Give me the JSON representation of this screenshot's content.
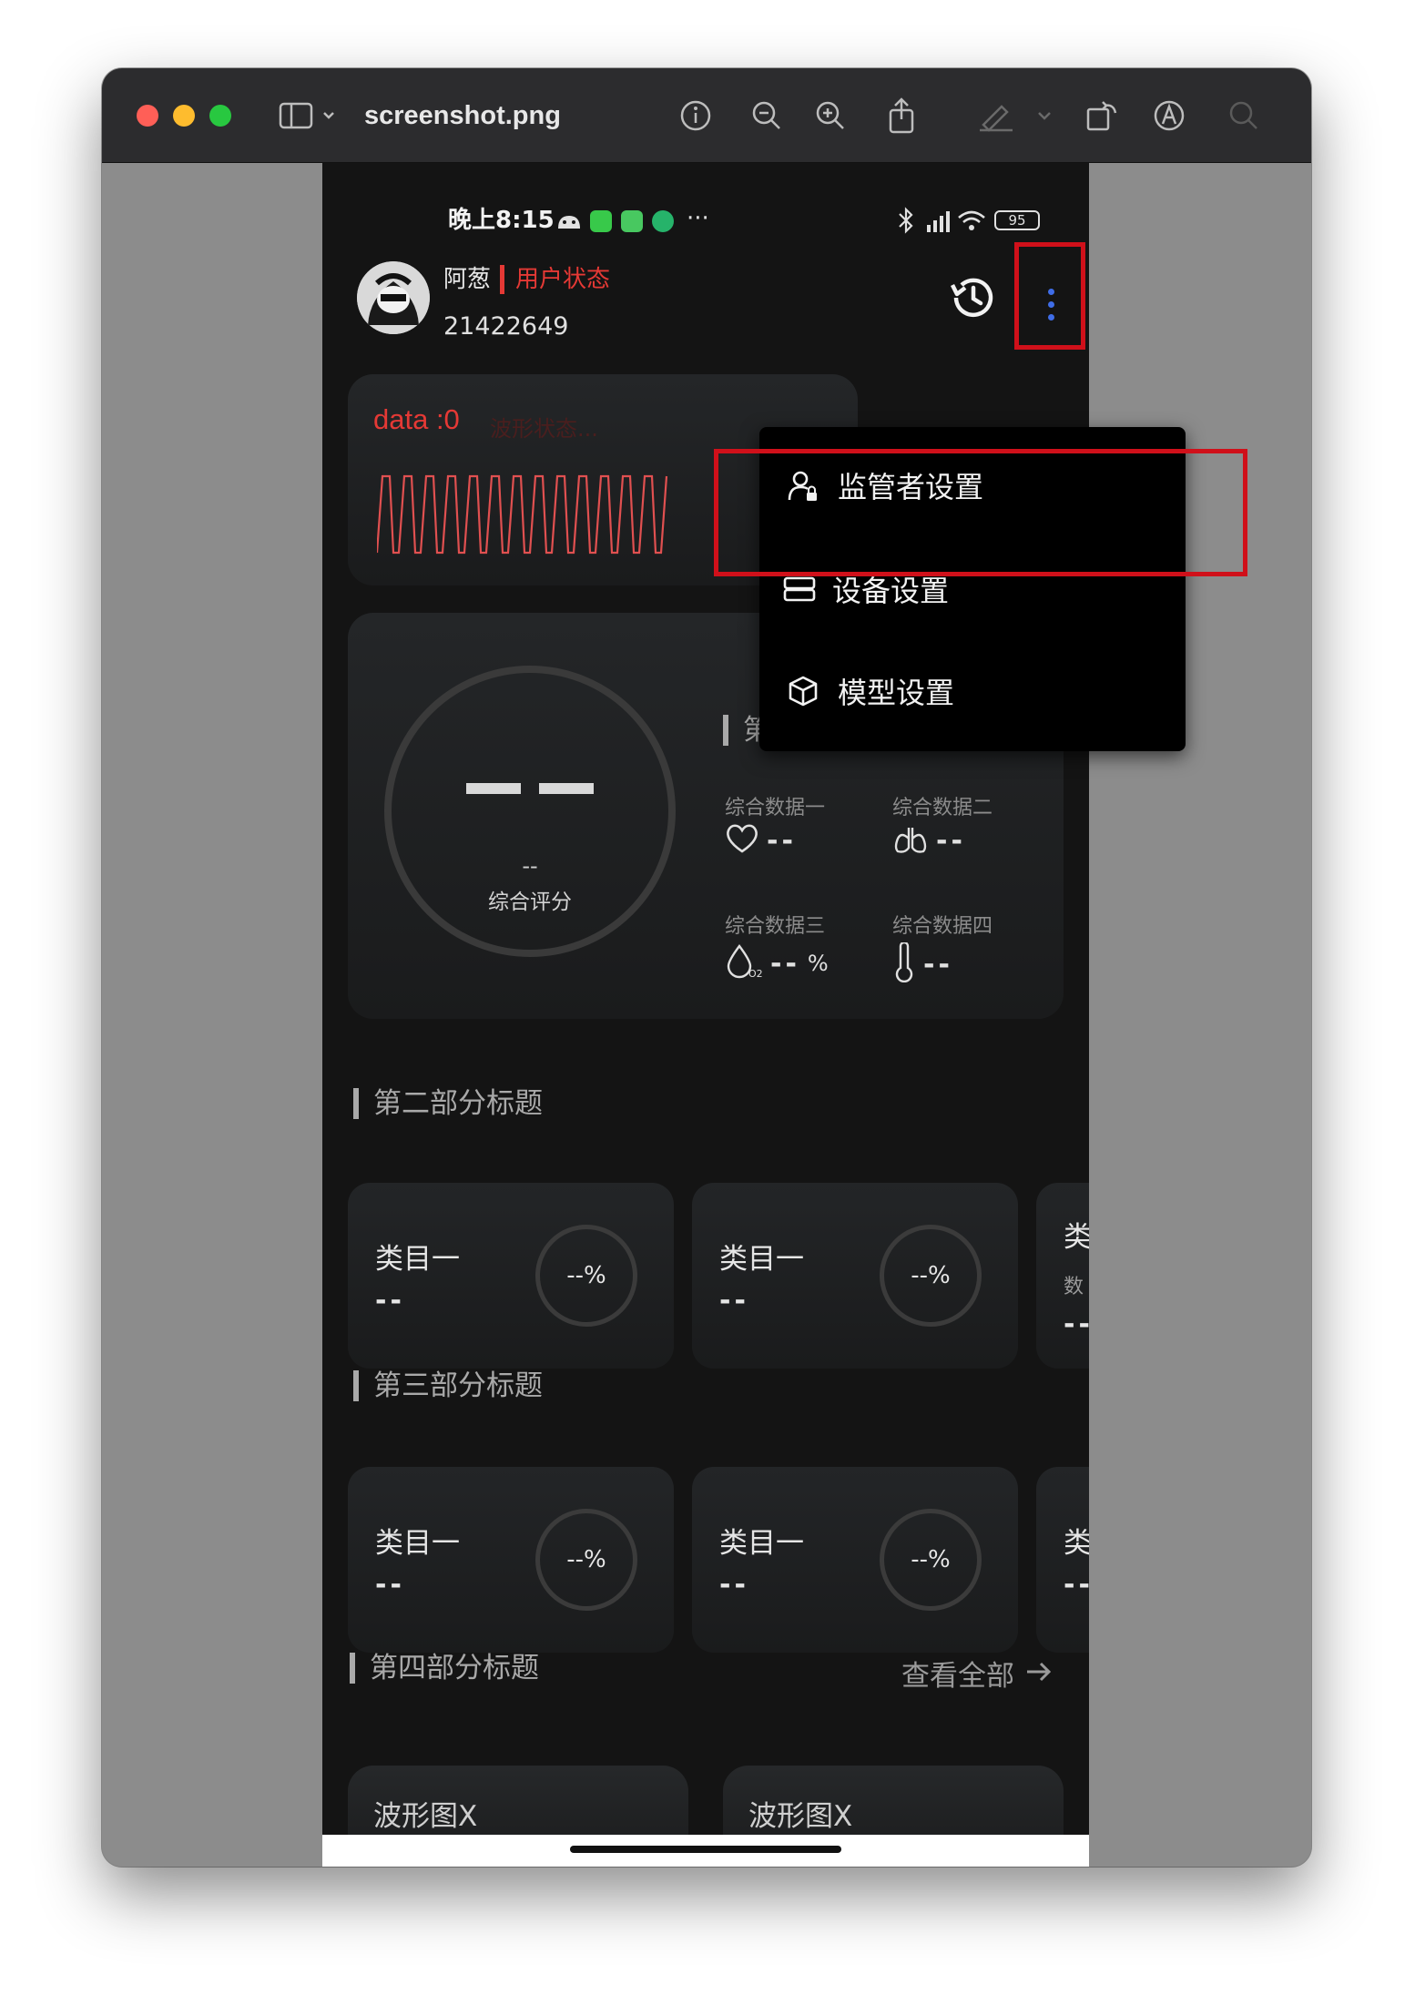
{
  "window": {
    "title": "screenshot.png"
  },
  "status_bar": {
    "time": "晚上8:15",
    "battery": "95"
  },
  "header": {
    "user_name": "阿葱",
    "user_status": "用户状态",
    "user_id": "21422649"
  },
  "wave_card": {
    "data_label": "data :0",
    "wave_status": "波形状态..."
  },
  "score": {
    "sub_value": "--",
    "label": "综合评分"
  },
  "section1": {
    "title": "第一部分标题",
    "metrics": [
      {
        "label": "综合数据一",
        "value": "--",
        "unit": "",
        "icon": "heart-icon"
      },
      {
        "label": "综合数据二",
        "value": "--",
        "unit": "",
        "icon": "lungs-icon"
      },
      {
        "label": "综合数据三",
        "value": "--",
        "unit": "%",
        "icon": "oxygen-drop-icon"
      },
      {
        "label": "综合数据四",
        "value": "--",
        "unit": "",
        "icon": "thermometer-icon"
      }
    ]
  },
  "section2": {
    "title": "第二部分标题",
    "cards": [
      {
        "name": "类目一",
        "value": "--",
        "percent": "--%"
      },
      {
        "name": "类目一",
        "value": "--",
        "percent": "--%"
      },
      {
        "name": "类",
        "sub": "数",
        "value": "--"
      }
    ]
  },
  "section3": {
    "title": "第三部分标题",
    "cards": [
      {
        "name": "类目一",
        "value": "--",
        "percent": "--%"
      },
      {
        "name": "类目一",
        "value": "--",
        "percent": "--%"
      },
      {
        "name": "类",
        "value": "--"
      }
    ]
  },
  "section4": {
    "title": "第四部分标题",
    "view_all": "查看全部",
    "cards": [
      {
        "title": "波形图X"
      },
      {
        "title": "波形图X"
      }
    ]
  },
  "menu": {
    "items": [
      {
        "label": "监管者设置",
        "icon": "supervisor-icon"
      },
      {
        "label": "设备设置",
        "icon": "device-icon"
      },
      {
        "label": "模型设置",
        "icon": "cube-icon"
      }
    ]
  },
  "colors": {
    "accent_red": "#e53935",
    "highlight_red": "#d0101a",
    "menu_dots_blue": "#3f6de8"
  }
}
